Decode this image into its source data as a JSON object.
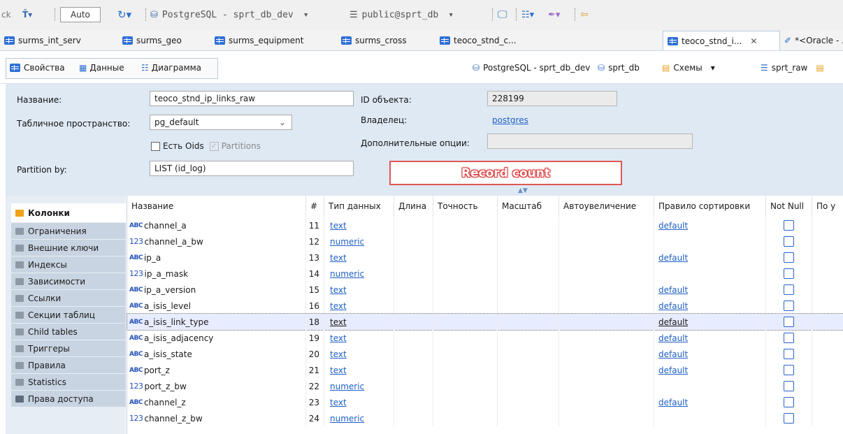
{
  "toolbar": {
    "ck": "ck",
    "auto": "Auto",
    "connection": "PostgreSQL - sprt_db_dev",
    "schema": "public@sprt_db"
  },
  "tabs": [
    {
      "label": "surms_int_serv"
    },
    {
      "label": "surms_geo"
    },
    {
      "label": "surms_equipment"
    },
    {
      "label": "surms_cross"
    },
    {
      "label": "teoco_stnd_c..."
    },
    {
      "label": "teoco_stnd_i...",
      "active": true
    },
    {
      "label": "*<Oracle - ."
    }
  ],
  "editor_tabs": [
    {
      "label": "Свойства"
    },
    {
      "label": "Данные"
    },
    {
      "label": "Диаграмма"
    }
  ],
  "breadcrumb": {
    "connection": "PostgreSQL - sprt_db_dev",
    "database": "sprt_db",
    "schemas": "Схемы",
    "schema": "sprt_raw"
  },
  "props": {
    "name_label": "Название:",
    "name_value": "teoco_stnd_ip_links_raw",
    "tablespace_label": "Табличное пространство:",
    "tablespace_value": "pg_default",
    "oids_label": "Есть Oids",
    "partitions_label": "Partitions",
    "partition_by_label": "Partition by:",
    "partition_by_value": "LIST (id_log)",
    "object_id_label": "ID объекта:",
    "object_id_value": "228199",
    "owner_label": "Владелец:",
    "owner_value": "postgres",
    "extra_label": "Дополнительные опции:",
    "extra_value": ""
  },
  "record_count_label": "Record count",
  "nav": [
    {
      "label": "Колонки",
      "active": true
    },
    {
      "label": "Ограничения"
    },
    {
      "label": "Внешние ключи"
    },
    {
      "label": "Индексы"
    },
    {
      "label": "Зависимости"
    },
    {
      "label": "Ссылки"
    },
    {
      "label": "Секции таблиц"
    },
    {
      "label": "Child tables"
    },
    {
      "label": "Триггеры"
    },
    {
      "label": "Правила"
    },
    {
      "label": "Statistics"
    },
    {
      "label": "Права доступа"
    }
  ],
  "columns_header": {
    "name": "Название",
    "num": "#",
    "type": "Тип данных",
    "length": "Длина",
    "precision": "Точность",
    "scale": "Масштаб",
    "autoinc": "Автоувеличение",
    "collation": "Правило сортировки",
    "notnull": "Not Null",
    "default": "По у"
  },
  "rows": [
    {
      "icon": "ABC",
      "name": "channel_a",
      "num": "11",
      "type": "text",
      "collation": "default"
    },
    {
      "icon": "123",
      "name": "channel_a_bw",
      "num": "12",
      "type": "numeric",
      "collation": ""
    },
    {
      "icon": "ABC",
      "name": "ip_a",
      "num": "13",
      "type": "text",
      "collation": "default"
    },
    {
      "icon": "123",
      "name": "ip_a_mask",
      "num": "14",
      "type": "numeric",
      "collation": ""
    },
    {
      "icon": "ABC",
      "name": "ip_a_version",
      "num": "15",
      "type": "text",
      "collation": "default"
    },
    {
      "icon": "ABC",
      "name": "a_isis_level",
      "num": "16",
      "type": "text",
      "collation": "default"
    },
    {
      "icon": "ABC",
      "name": "a_isis_link_type",
      "num": "18",
      "type": "text",
      "collation": "default",
      "selected": true
    },
    {
      "icon": "ABC",
      "name": "a_isis_adjacency",
      "num": "19",
      "type": "text",
      "collation": "default"
    },
    {
      "icon": "ABC",
      "name": "a_isis_state",
      "num": "20",
      "type": "text",
      "collation": "default"
    },
    {
      "icon": "ABC",
      "name": "port_z",
      "num": "21",
      "type": "text",
      "collation": "default"
    },
    {
      "icon": "123",
      "name": "port_z_bw",
      "num": "22",
      "type": "numeric",
      "collation": ""
    },
    {
      "icon": "ABC",
      "name": "channel_z",
      "num": "23",
      "type": "text",
      "collation": "default"
    },
    {
      "icon": "123",
      "name": "channel_z_bw",
      "num": "24",
      "type": "numeric",
      "collation": ""
    }
  ]
}
